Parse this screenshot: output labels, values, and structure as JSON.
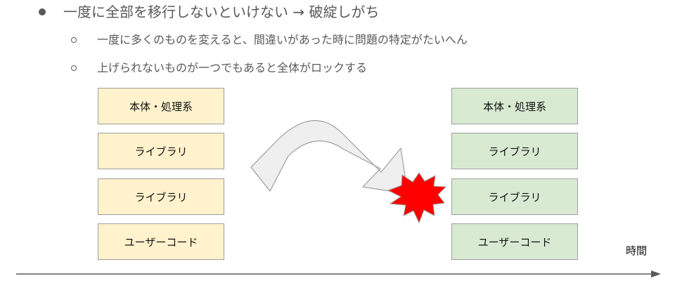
{
  "bullets": {
    "main": "一度に全部を移行しないといけない → 破綻しがち",
    "sub": [
      "一度に多くのものを変えると、間違いがあった時に問題の特定がたいへん",
      "上げられないものが一つでもあると全体がロックする"
    ]
  },
  "stacks": {
    "before": {
      "color": "#fff2cc",
      "layers": [
        "本体・処理系",
        "ライブラリ",
        "ライブラリ",
        "ユーザーコード"
      ]
    },
    "after": {
      "color": "#d9ead3",
      "layers": [
        "本体・処理系",
        "ライブラリ",
        "ライブラリ",
        "ユーザーコード"
      ]
    }
  },
  "timeline": {
    "label": "時間"
  },
  "colors": {
    "text": "#595959",
    "burst": "#ff0000",
    "arrow_fill": "#efefef"
  }
}
